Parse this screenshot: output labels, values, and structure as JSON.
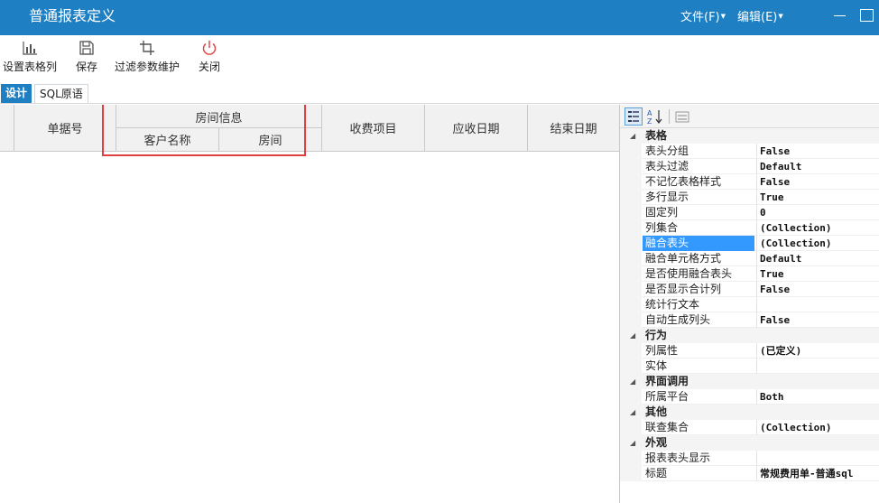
{
  "window": {
    "title": "普通报表定义",
    "menus": [
      {
        "label": "文件(F)"
      },
      {
        "label": "编辑(E)"
      }
    ]
  },
  "toolbar": {
    "items": [
      {
        "label": "设置表格列",
        "icon": "bar-chart-icon"
      },
      {
        "label": "保存",
        "icon": "floppy-disk-icon"
      },
      {
        "label": "过滤参数维护",
        "icon": "crop-icon"
      },
      {
        "label": "关闭",
        "icon": "power-icon"
      }
    ]
  },
  "tabs": [
    {
      "label": "设计",
      "active": true
    },
    {
      "label": "SQL原语",
      "active": false
    }
  ],
  "grid": {
    "columns": {
      "bill_no": "单据号",
      "room_info": "房间信息",
      "customer_name": "客户名称",
      "room": "房间",
      "fee_item": "收费项目",
      "due_date": "应收日期",
      "end_date": "结束日期"
    }
  },
  "properties": {
    "categories": [
      {
        "name": "表格",
        "items": [
          {
            "name": "表头分组",
            "value": "False"
          },
          {
            "name": "表头过滤",
            "value": "Default"
          },
          {
            "name": "不记忆表格样式",
            "value": "False"
          },
          {
            "name": "多行显示",
            "value": "True"
          },
          {
            "name": "固定列",
            "value": "0"
          },
          {
            "name": "列集合",
            "value": "(Collection)"
          },
          {
            "name": "融合表头",
            "value": "(Collection)",
            "selected": true
          },
          {
            "name": "融合单元格方式",
            "value": "Default"
          },
          {
            "name": "是否使用融合表头",
            "value": "True"
          },
          {
            "name": "是否显示合计列",
            "value": "False"
          },
          {
            "name": "统计行文本",
            "value": ""
          },
          {
            "name": "自动生成列头",
            "value": "False"
          }
        ]
      },
      {
        "name": "行为",
        "items": [
          {
            "name": "列属性",
            "value": "(已定义)"
          },
          {
            "name": "实体",
            "value": ""
          }
        ]
      },
      {
        "name": "界面调用",
        "items": [
          {
            "name": "所属平台",
            "value": "Both"
          }
        ]
      },
      {
        "name": "其他",
        "items": [
          {
            "name": "联查集合",
            "value": "(Collection)"
          }
        ]
      },
      {
        "name": "外观",
        "items": [
          {
            "name": "报表表头显示",
            "value": ""
          },
          {
            "name": "标题",
            "value": "常规费用单-普通sql"
          }
        ]
      }
    ]
  },
  "colors": {
    "titlebar": "#1e7fc3",
    "selection": "#3399ff",
    "highlight": "#e04040"
  }
}
